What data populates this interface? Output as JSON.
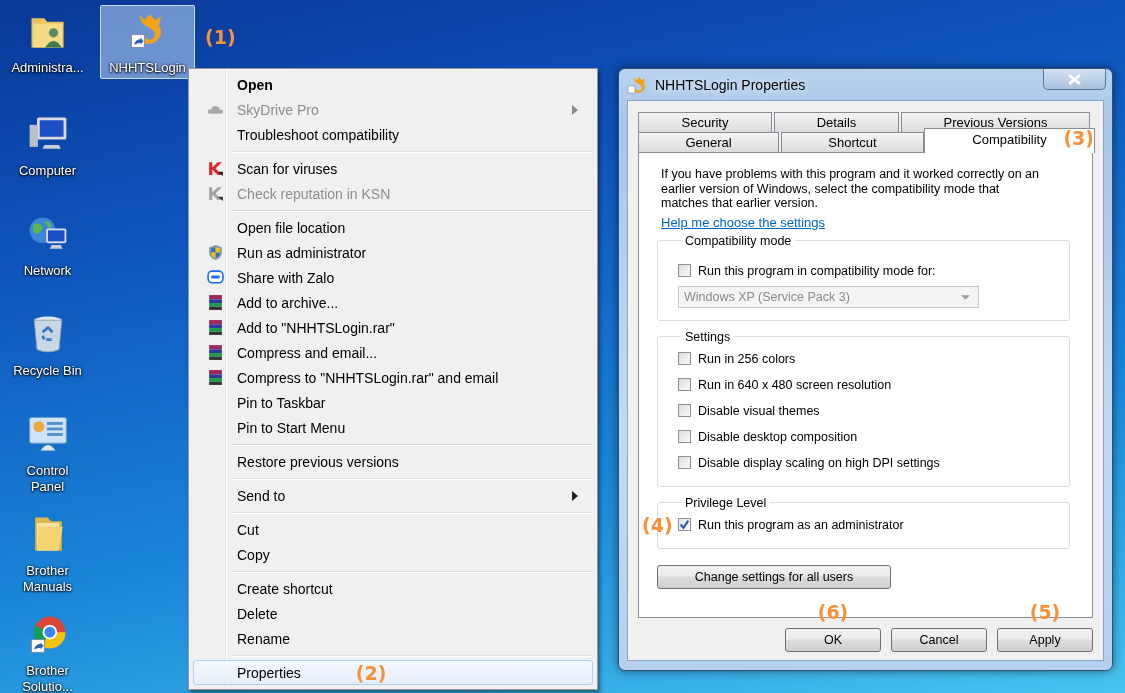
{
  "desktop_icons": [
    {
      "label": "Administra...",
      "kind": "user-folder",
      "selected": false
    },
    {
      "label": "NHHTSLogin",
      "kind": "app-shortcut",
      "selected": true,
      "annotation": "(1)"
    },
    {
      "label": "Computer",
      "kind": "computer",
      "selected": false
    },
    {
      "label": "Network",
      "kind": "network",
      "selected": false
    },
    {
      "label": "Recycle Bin",
      "kind": "recycle-bin",
      "selected": false
    },
    {
      "label": "Control Panel",
      "kind": "control-panel",
      "selected": false
    },
    {
      "label": "Brother Manuals",
      "kind": "folder",
      "selected": false
    },
    {
      "label": "Brother Solutio...",
      "kind": "browser-shortcut",
      "selected": false
    }
  ],
  "context_menu": {
    "groups": [
      [
        {
          "label": "Open",
          "kind": "plain",
          "default": true,
          "disabled": false,
          "submenu": false,
          "selected": false
        },
        {
          "label": "SkyDrive Pro",
          "kind": "cloud",
          "default": false,
          "disabled": true,
          "submenu": true,
          "selected": false
        },
        {
          "label": "Troubleshoot compatibility",
          "kind": "plain",
          "default": false,
          "disabled": false,
          "submenu": false,
          "selected": false
        }
      ],
      [
        {
          "label": "Scan for viruses",
          "kind": "antivirus",
          "default": false,
          "disabled": false,
          "submenu": false,
          "selected": false
        },
        {
          "label": "Check reputation in KSN",
          "kind": "antivirus",
          "default": false,
          "disabled": true,
          "submenu": false,
          "selected": false
        }
      ],
      [
        {
          "label": "Open file location",
          "kind": "plain",
          "default": false,
          "disabled": false,
          "submenu": false,
          "selected": false
        },
        {
          "label": "Run as administrator",
          "kind": "shield",
          "default": false,
          "disabled": false,
          "submenu": false,
          "selected": false
        },
        {
          "label": "Share with Zalo",
          "kind": "chat",
          "default": false,
          "disabled": false,
          "submenu": false,
          "selected": false
        },
        {
          "label": "Add to archive...",
          "kind": "archive",
          "default": false,
          "disabled": false,
          "submenu": false,
          "selected": false
        },
        {
          "label": "Add to \"NHHTSLogin.rar\"",
          "kind": "archive",
          "default": false,
          "disabled": false,
          "submenu": false,
          "selected": false
        },
        {
          "label": "Compress and email...",
          "kind": "archive",
          "default": false,
          "disabled": false,
          "submenu": false,
          "selected": false
        },
        {
          "label": "Compress to \"NHHTSLogin.rar\" and email",
          "kind": "archive",
          "default": false,
          "disabled": false,
          "submenu": false,
          "selected": false
        },
        {
          "label": "Pin to Taskbar",
          "kind": "plain",
          "default": false,
          "disabled": false,
          "submenu": false,
          "selected": false
        },
        {
          "label": "Pin to Start Menu",
          "kind": "plain",
          "default": false,
          "disabled": false,
          "submenu": false,
          "selected": false
        }
      ],
      [
        {
          "label": "Restore previous versions",
          "kind": "plain",
          "default": false,
          "disabled": false,
          "submenu": false,
          "selected": false
        }
      ],
      [
        {
          "label": "Send to",
          "kind": "plain",
          "default": false,
          "disabled": false,
          "submenu": true,
          "selected": false
        }
      ],
      [
        {
          "label": "Cut",
          "kind": "plain",
          "default": false,
          "disabled": false,
          "submenu": false,
          "selected": false
        },
        {
          "label": "Copy",
          "kind": "plain",
          "default": false,
          "disabled": false,
          "submenu": false,
          "selected": false
        }
      ],
      [
        {
          "label": "Create shortcut",
          "kind": "plain",
          "default": false,
          "disabled": false,
          "submenu": false,
          "selected": false
        },
        {
          "label": "Delete",
          "kind": "plain",
          "default": false,
          "disabled": false,
          "submenu": false,
          "selected": false
        },
        {
          "label": "Rename",
          "kind": "plain",
          "default": false,
          "disabled": false,
          "submenu": false,
          "selected": false
        }
      ],
      [
        {
          "label": "Properties",
          "kind": "plain",
          "default": false,
          "disabled": false,
          "submenu": false,
          "selected": true,
          "annotation": "(2)"
        }
      ]
    ]
  },
  "dialog": {
    "title": "NHHTSLogin Properties",
    "tab_rows": [
      [
        {
          "label": "Security",
          "selected": false
        },
        {
          "label": "Details",
          "selected": false
        },
        {
          "label": "Previous Versions",
          "selected": false
        }
      ],
      [
        {
          "label": "General",
          "selected": false
        },
        {
          "label": "Shortcut",
          "selected": false
        },
        {
          "label": "Compatibility",
          "selected": true,
          "annotation": "(3)"
        }
      ]
    ],
    "intro": "If you have problems with this program and it worked correctly on an earlier version of Windows, select the compatibility mode that matches that earlier version.",
    "help_link": "Help me choose the settings",
    "groups": [
      {
        "title": "Compatibility mode",
        "options": [
          {
            "label": "Run this program in compatibility mode for:",
            "checked": false
          }
        ],
        "dropdown": {
          "value": "Windows XP (Service Pack 3)",
          "disabled": true
        }
      },
      {
        "title": "Settings",
        "options": [
          {
            "label": "Run in 256 colors",
            "checked": false
          },
          {
            "label": "Run in 640 x 480 screen resolution",
            "checked": false
          },
          {
            "label": "Disable visual themes",
            "checked": false
          },
          {
            "label": "Disable desktop composition",
            "checked": false
          },
          {
            "label": "Disable display scaling on high DPI settings",
            "checked": false
          }
        ]
      },
      {
        "title": "Privilege Level",
        "options": [
          {
            "label": "Run this program as an administrator",
            "checked": true,
            "annotation": "(4)"
          }
        ]
      }
    ],
    "all_users_button": "Change settings for all users",
    "buttons": [
      {
        "label": "OK",
        "annotation": "(6)"
      },
      {
        "label": "Cancel"
      },
      {
        "label": "Apply",
        "annotation": "(5)"
      }
    ]
  }
}
